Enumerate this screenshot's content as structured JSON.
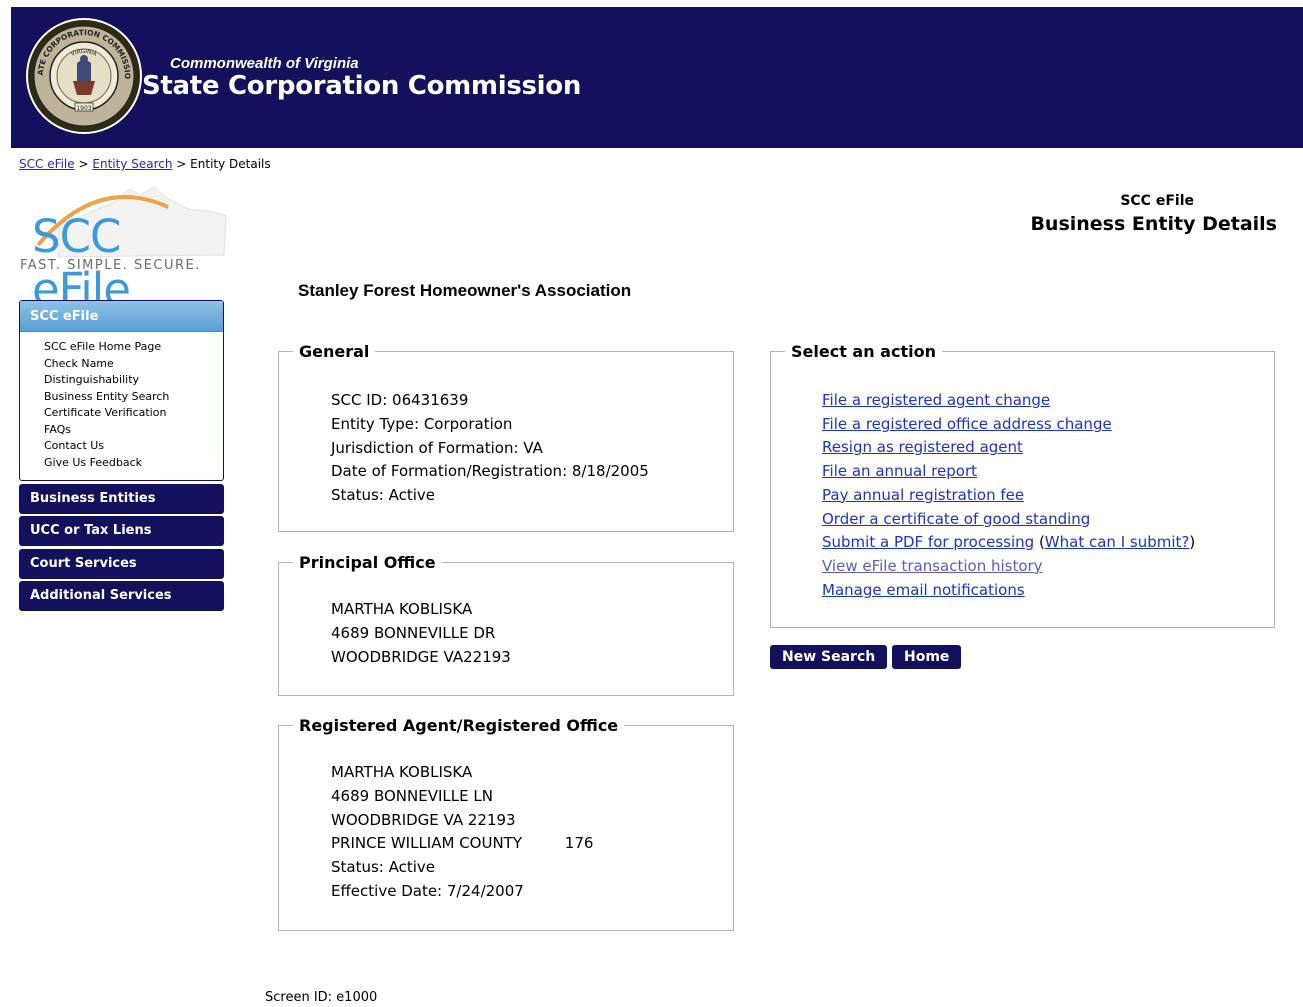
{
  "banner": {
    "subtitle": "Commonwealth of Virginia",
    "title": "State Corporation Commission",
    "seal": {
      "top": "STATE CORPORATION COMMISSION",
      "inner": "VIRGINIA",
      "year": "1903"
    }
  },
  "breadcrumb": {
    "link1": "SCC eFile",
    "sep1": ">",
    "link2": "Entity Search",
    "sep2": ">",
    "current": "Entity Details"
  },
  "logo": {
    "text": "SCC eFile",
    "tagline": "FAST.  SIMPLE.  SECURE."
  },
  "sidebar": {
    "header": "SCC eFile",
    "items": [
      "SCC eFile Home Page",
      "Check Name",
      "Distinguishability",
      "Business Entity Search",
      "Certificate Verification",
      "FAQs",
      "Contact Us",
      "Give Us Feedback"
    ],
    "nav": [
      "Business Entities",
      "UCC or Tax Liens",
      "Court Services",
      "Additional Services"
    ]
  },
  "header": {
    "small": "SCC eFile",
    "large": "Business Entity Details"
  },
  "entity_name": "Stanley Forest Homeowner's Association",
  "general": {
    "legend": "General",
    "lines": [
      "SCC ID: 06431639",
      "Entity Type: Corporation",
      "Jurisdiction of Formation: VA",
      "Date of Formation/Registration: 8/18/2005",
      "Status: Active"
    ]
  },
  "principal_office": {
    "legend": "Principal Office",
    "lines": [
      "MARTHA KOBLISKA",
      "4689 BONNEVILLE DR",
      "WOODBRIDGE VA22193"
    ]
  },
  "registered_agent": {
    "legend": "Registered Agent/Registered Office",
    "lines": [
      "MARTHA KOBLISKA",
      "4689 BONNEVILLE LN",
      "WOODBRIDGE VA 22193"
    ],
    "county": "PRINCE WILLIAM COUNTY",
    "county_code": "176",
    "status": "Status: Active",
    "effective": "Effective Date: 7/24/2007"
  },
  "actions": {
    "legend": "Select an action",
    "links": [
      "File a registered agent change",
      "File a registered office address change",
      "Resign as registered agent",
      "File an annual report",
      "Pay annual registration fee",
      "Order a certificate of good standing"
    ],
    "pdf_link": "Submit a PDF for processing",
    "pdf_open": " (",
    "pdf_help": "What can I submit?",
    "pdf_close": ")",
    "history_link": "View eFile transaction history",
    "email_link": "Manage email notifications"
  },
  "buttons": {
    "new_search": "New Search",
    "home": "Home"
  },
  "footer": {
    "screen_id": "Screen ID: e1000"
  }
}
